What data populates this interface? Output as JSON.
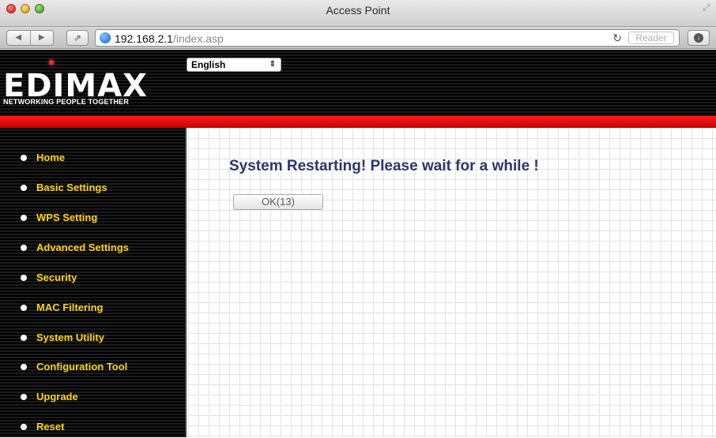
{
  "window": {
    "title": "Access Point"
  },
  "browser": {
    "url_host": "192.168.2.1",
    "url_path": "/index.asp",
    "reader_label": "Reader"
  },
  "header": {
    "brand": "EDIMAX",
    "tagline": "NETWORKING PEOPLE TOGETHER",
    "language": "English"
  },
  "sidebar": {
    "items": [
      {
        "label": "Home"
      },
      {
        "label": "Basic Settings"
      },
      {
        "label": "WPS Setting"
      },
      {
        "label": "Advanced Settings"
      },
      {
        "label": "Security"
      },
      {
        "label": "MAC Filtering"
      },
      {
        "label": "System Utility"
      },
      {
        "label": "Configuration Tool"
      },
      {
        "label": "Upgrade"
      },
      {
        "label": "Reset"
      }
    ]
  },
  "main": {
    "message": "System Restarting! Please wait for a while !",
    "ok_button": "OK(13)"
  },
  "colors": {
    "nav_text": "#ffd800",
    "accent_bar": "#e00000",
    "message_text": "#2e3570"
  }
}
